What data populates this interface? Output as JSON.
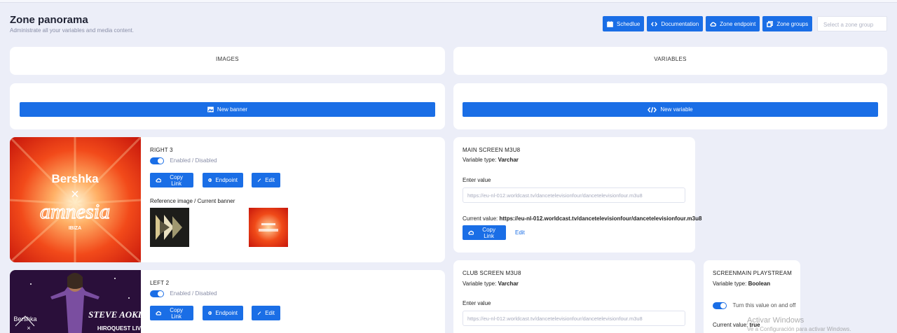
{
  "header": {
    "title": "Zone panorama",
    "subtitle": "Administrate all your variables and media content.",
    "buttons": [
      {
        "label": "Schedlue",
        "icon": "calendar-icon"
      },
      {
        "label": "Documentation",
        "icon": "code-icon"
      },
      {
        "label": "Zone endpoint",
        "icon": "cloud-icon"
      },
      {
        "label": "Zone groups",
        "icon": "folders-icon"
      }
    ],
    "zone_select_placeholder": "Select a zone group"
  },
  "tabs": {
    "images": "IMAGES",
    "variables": "VARIABLES"
  },
  "actions": {
    "new_banner": "New banner",
    "new_variable": "New variable"
  },
  "banners": [
    {
      "name": "RIGHT 3",
      "toggle_label": "Enabled / Disabled",
      "enabled": true,
      "buttons": {
        "copy": "Copy Link",
        "endpoint": "Endpoint",
        "edit": "Edit"
      },
      "reference_label": "Reference image / Current banner",
      "image_text": {
        "brand": "Bershka",
        "x": "×",
        "logo": "amnesia",
        "sub": "IBIZA"
      }
    },
    {
      "name": "LEFT 2",
      "toggle_label": "Enabled / Disabled",
      "enabled": true,
      "buttons": {
        "copy": "Copy Link",
        "endpoint": "Endpoint",
        "edit": "Edit"
      },
      "image_text": {
        "brand": "Bershka",
        "x": "×",
        "artist": "STEVE AOKI",
        "event": "HIROQUEST LIVE PA"
      }
    }
  ],
  "variables": [
    {
      "name": "MAIN SCREEN M3U8",
      "type_label": "Variable type:",
      "type_value": "Varchar",
      "enter_label": "Enter value",
      "input_value": "https://eu-nl-012.worldcast.tv/dancetelevisionfour/dancetelevisionfour.m3u8",
      "current_label": "Current value:",
      "current_value": "https://eu-nl-012.worldcast.tv/dancetelevisionfour/dancetelevisionfour.m3u8",
      "copy_label": "Copy Link",
      "edit_label": "Edit"
    },
    {
      "name": "CLUB SCREEN M3U8",
      "type_label": "Variable type:",
      "type_value": "Varchar",
      "enter_label": "Enter value",
      "input_value": "https://eu-nl-012.worldcast.tv/dancetelevisionfour/dancetelevisionfour.m3u8"
    },
    {
      "name": "SCREENMAIN PLAYSTREAM",
      "type_label": "Variable type:",
      "type_value": "Boolean",
      "toggle_label": "Turn this value on and off",
      "current_label": "Current value:",
      "current_value": "true"
    }
  ],
  "watermark": {
    "line1": "Activar Windows",
    "line2": "Ve a Configuración para activar Windows."
  },
  "colors": {
    "primary": "#1a6ee6",
    "background": "#eceef8"
  }
}
